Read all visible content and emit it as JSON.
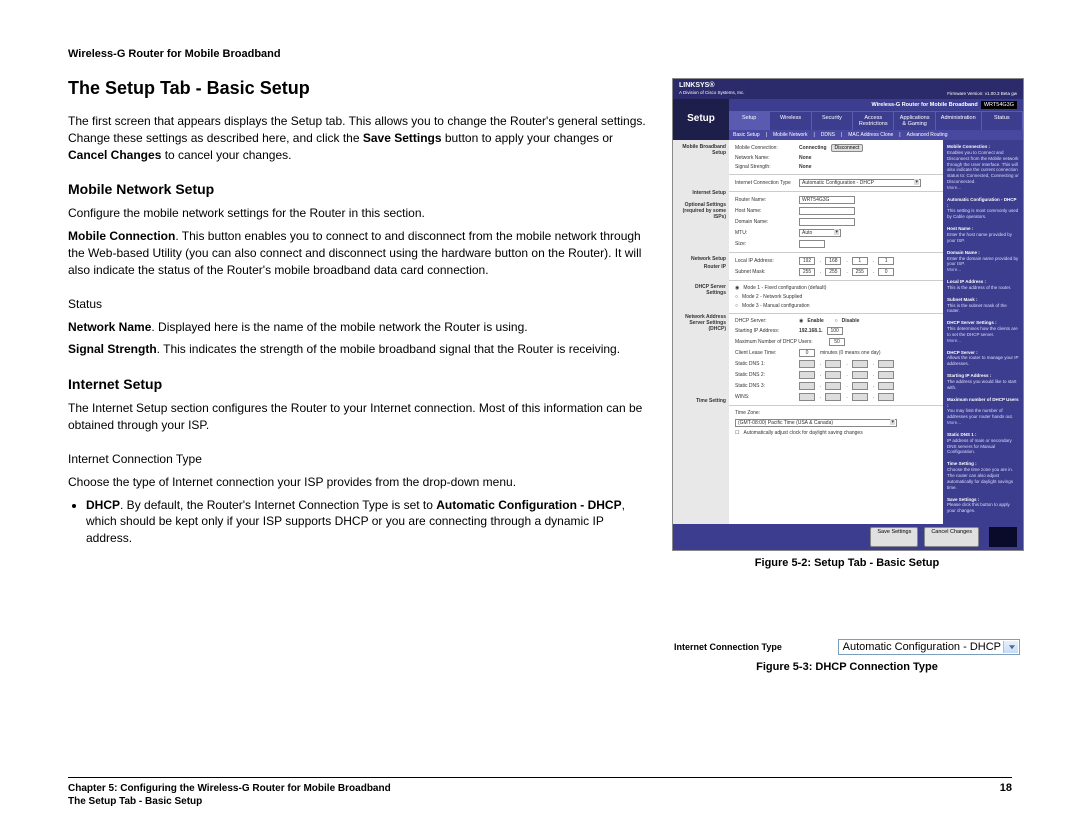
{
  "header": "Wireless-G Router for Mobile Broadband",
  "title": "The Setup Tab - Basic Setup",
  "intro_parts": {
    "p1": "The first screen that appears displays the Setup tab. This allows you to change the Router's general settings. Change these settings as described here, and click the ",
    "b1": "Save Settings",
    "p2": " button to apply your changes or ",
    "b2": "Cancel Changes",
    "p3": " to cancel your changes."
  },
  "h2_mobile": "Mobile Network Setup",
  "mobile_cfg": "Configure the mobile network settings for the Router in this section.",
  "mc_bold": "Mobile Connection",
  "mc_text": ". This button enables you to connect to and disconnect from the mobile network through the Web-based Utility (you can also connect and disconnect using the hardware button on the Router). It will also indicate the status of the Router's mobile broadband data card connection.",
  "h3_status": "Status",
  "nn_bold": "Network Name",
  "nn_text": ". Displayed here is the name of the mobile network the Router is using.",
  "ss_bold": "Signal Strength",
  "ss_text": ". This indicates the strength of the mobile broadband signal that the Router is receiving.",
  "h2_internet": "Internet Setup",
  "internet_text": "The Internet Setup section configures the Router to your Internet connection. Most of this information can be obtained through your ISP.",
  "h3_ict": "Internet Connection Type",
  "ict_text": "Choose the type of Internet connection your ISP provides from the drop-down menu.",
  "dhcp_bold": "DHCP",
  "dhcp_t1": ". By default, the Router's Internet Connection Type is set to ",
  "dhcp_b2": "Automatic Configuration - DHCP",
  "dhcp_t2": ", which should be kept only if your ISP supports DHCP or you are connecting through a dynamic IP address.",
  "fig52_caption": "Figure 5-2: Setup Tab - Basic Setup",
  "fig53_caption": "Figure 5-3: DHCP Connection Type",
  "fig53_label": "Internet Connection Type",
  "fig53_value": "Automatic Configuration - DHCP",
  "footer_l1": "Chapter 5: Configuring the Wireless-G Router for Mobile Broadband",
  "footer_l2": "The Setup Tab - Basic Setup",
  "footer_page": "18",
  "ss": {
    "brand": "LINKSYS®",
    "brand_sub": "A Division of Cisco Systems, Inc.",
    "fw": "Firmware Version: v1.00.3 Beta gw",
    "product": "Wireless-G Router for Mobile Broadband",
    "model": "WRT54G3G",
    "setup": "Setup",
    "tabs": [
      "Setup",
      "Wireless",
      "Security",
      "Access Restrictions",
      "Applications & Gaming",
      "Administration",
      "Status"
    ],
    "subtabs": [
      "Basic Setup",
      "|",
      "Mobile Network",
      "|",
      "DDNS",
      "|",
      "MAC Address Clone",
      "|",
      "Advanced Routing"
    ],
    "side": {
      "mobile": "Mobile Broadband Setup",
      "internet": "Internet Setup",
      "opt": "Optional Settings (required by some ISPs)",
      "network": "Network Setup",
      "routerip": "Router IP",
      "dhcp": "DHCP Server Settings",
      "nas": "Network Address Server Settings (DHCP)",
      "tz": "Time Setting"
    },
    "fields": {
      "mobile_conn": "Mobile Connection:",
      "mobile_conn_val": "Connecting",
      "mobile_btn": "Disconnect",
      "net_name": "Network Name:",
      "net_name_val": "None",
      "sig": "Signal Strength:",
      "sig_val": "None",
      "ict": "Internet Connection Type",
      "ict_val": "Automatic Configuration - DHCP",
      "router_name": "Router Name:",
      "router_name_val": "WRT54G3G",
      "host_name": "Host Name:",
      "domain_name": "Domain Name:",
      "mtu": "MTU:",
      "mtu_val": "Auto",
      "size": "Size:",
      "local_ip": "Local IP Address:",
      "ip1": "192",
      "ip2": "168",
      "ip3": "1",
      "ip4": "1",
      "subnet": "Subnet Mask:",
      "sm1": "255",
      "sm2": "255",
      "sm3": "255",
      "sm4": "0",
      "mode1": "Mode 1 - Fixed configuration (default)",
      "mode2": "Mode 2 - Network Supplied",
      "mode3": "Mode 3 - Manual configuration",
      "dhcp_server": "DHCP Server:",
      "enable": "Enable",
      "disable": "Disable",
      "start_ip": "Starting IP Address:",
      "start_ip_prefix": "192.168.1.",
      "start_ip_val": "100",
      "max": "Maximum Number of DHCP Users:",
      "max_val": "50",
      "lease": "Client Lease Time:",
      "lease_val": "0",
      "lease_note": "minutes (0 means one day)",
      "sdns1": "Static DNS 1:",
      "sdns2": "Static DNS 2:",
      "sdns3": "Static DNS 3:",
      "wins": "WINS:",
      "tz": "Time Zone:",
      "tz_val": "(GMT-08:00) Pacific Time (USA & Canada)",
      "tz_chk": "Automatically adjust clock for daylight saving changes"
    },
    "help": [
      {
        "t": "Mobile Connection :",
        "b": "Enables you to Connect and Disconnect from the Mobile network through the User Interface. This will also indicate the current connection status to: Connected, Connecting or Disconnected."
      },
      {
        "t": "Automatic Configuration - DHCP :",
        "b": "This setting is most commonly used by Cable operators."
      },
      {
        "t": "Host Name :",
        "b": "Enter the host name provided by your ISP."
      },
      {
        "t": "Domain Name :",
        "b": "Enter the domain name provided by your ISP."
      },
      {
        "t": "Local IP Address :",
        "b": "This is the address of the router."
      },
      {
        "t": "Subnet Mask :",
        "b": "This is the subnet mask of the router."
      },
      {
        "t": "DHCP Server Settings :",
        "b": "This determines how the clients are to set the DHCP server."
      },
      {
        "t": "DHCP Server :",
        "b": "Allows the router to manage your IP addresses."
      },
      {
        "t": "Starting IP Address :",
        "b": "The address you would like to start with."
      },
      {
        "t": "Maximum number of DHCP Users :",
        "b": "You may limit the number of addresses your router hands out."
      },
      {
        "t": "Static DNS 1 :",
        "b": "IP address of main or secondary DNS servers for Manual Configuration."
      },
      {
        "t": "Time Setting :",
        "b": "Choose the time zone you are in. The router can also adjust automatically for daylight savings time."
      },
      {
        "t": "Save Settings :",
        "b": "Please click this button to apply your changes."
      }
    ],
    "buttons": {
      "save": "Save Settings",
      "cancel": "Cancel Changes"
    }
  }
}
